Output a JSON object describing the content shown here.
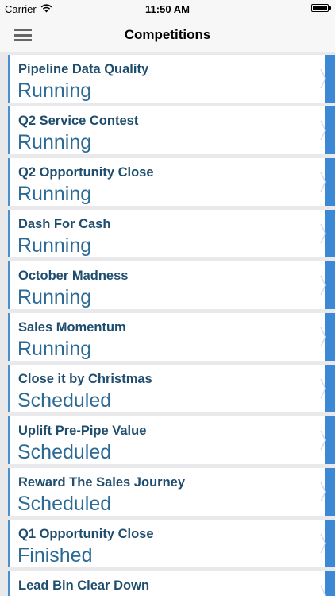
{
  "status_bar": {
    "carrier": "Carrier",
    "time": "11:50 AM",
    "wifi_icon": "wifi-icon",
    "battery_icon": "battery-icon"
  },
  "nav": {
    "title": "Competitions",
    "menu_icon": "hamburger-menu-icon"
  },
  "colors": {
    "accent": "#3d88d4",
    "title_text": "#1e4d6e",
    "status_text": "#2a6a95",
    "background": "#e9e9ec"
  },
  "competitions": [
    {
      "name": "Pipeline Data Quality",
      "status": "Running"
    },
    {
      "name": "Q2 Service Contest",
      "status": "Running"
    },
    {
      "name": "Q2 Opportunity Close",
      "status": "Running"
    },
    {
      "name": "Dash For Cash",
      "status": "Running"
    },
    {
      "name": "October Madness",
      "status": "Running"
    },
    {
      "name": "Sales Momentum",
      "status": "Running"
    },
    {
      "name": "Close it by Christmas",
      "status": "Scheduled"
    },
    {
      "name": "Uplift Pre-Pipe Value",
      "status": "Scheduled"
    },
    {
      "name": "Reward The Sales Journey",
      "status": "Scheduled"
    },
    {
      "name": "Q1 Opportunity Close",
      "status": "Finished"
    },
    {
      "name": "Lead Bin Clear Down",
      "status": ""
    }
  ]
}
